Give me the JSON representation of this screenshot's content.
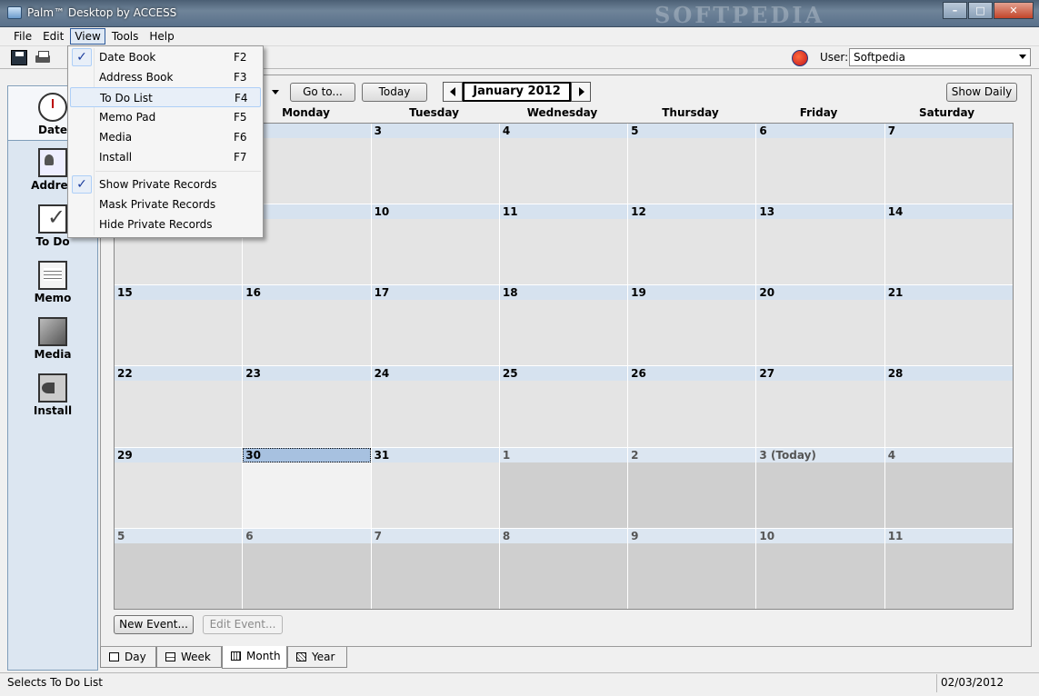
{
  "window": {
    "title": "Palm™ Desktop by ACCESS",
    "watermark": "SOFTPEDIA",
    "minimize": "–",
    "maximize": "□",
    "close": "✕"
  },
  "menubar": [
    "File",
    "Edit",
    "View",
    "Tools",
    "Help"
  ],
  "toolbar": {
    "user_label": "User:",
    "user_value": "Softpedia"
  },
  "view_menu": {
    "items": [
      {
        "label": "Date Book",
        "shortcut": "F2",
        "checked": true
      },
      {
        "label": "Address Book",
        "shortcut": "F3"
      },
      {
        "label": "To Do List",
        "shortcut": "F4",
        "hover": true
      },
      {
        "label": "Memo Pad",
        "shortcut": "F5"
      },
      {
        "label": "Media",
        "shortcut": "F6"
      },
      {
        "label": "Install",
        "shortcut": "F7"
      }
    ],
    "private_items": [
      {
        "label": "Show Private Records",
        "checked": true
      },
      {
        "label": "Mask Private Records"
      },
      {
        "label": "Hide Private Records"
      }
    ]
  },
  "sidebar": {
    "items": [
      {
        "label": "Date",
        "icon": "date-book-icon"
      },
      {
        "label": "Addres",
        "icon": "address-book-icon"
      },
      {
        "label": "To Do",
        "icon": "todo-list-icon"
      },
      {
        "label": "Memo",
        "icon": "memo-pad-icon"
      },
      {
        "label": "Media",
        "icon": "media-icon"
      },
      {
        "label": "Install",
        "icon": "install-icon"
      }
    ]
  },
  "calendar": {
    "goto_label": "Go to...",
    "today_label": "Today",
    "month_label": "January 2012",
    "show_daily_label": "Show Daily",
    "weekdays": [
      "",
      "Monday",
      "Tuesday",
      "Wednesday",
      "Thursday",
      "Friday",
      "Saturday"
    ],
    "weeks": [
      [
        {
          "d": ""
        },
        {
          "d": ""
        },
        {
          "d": "3"
        },
        {
          "d": "4"
        },
        {
          "d": "5"
        },
        {
          "d": "6"
        },
        {
          "d": "7"
        }
      ],
      [
        {
          "d": ""
        },
        {
          "d": ""
        },
        {
          "d": "10"
        },
        {
          "d": "11"
        },
        {
          "d": "12"
        },
        {
          "d": "13"
        },
        {
          "d": "14"
        }
      ],
      [
        {
          "d": "15"
        },
        {
          "d": "16"
        },
        {
          "d": "17"
        },
        {
          "d": "18"
        },
        {
          "d": "19"
        },
        {
          "d": "20"
        },
        {
          "d": "21"
        }
      ],
      [
        {
          "d": "22"
        },
        {
          "d": "23"
        },
        {
          "d": "24"
        },
        {
          "d": "25"
        },
        {
          "d": "26"
        },
        {
          "d": "27"
        },
        {
          "d": "28"
        }
      ],
      [
        {
          "d": "29"
        },
        {
          "d": "30",
          "selected": true
        },
        {
          "d": "31"
        },
        {
          "d": "1",
          "other": true
        },
        {
          "d": "2",
          "other": true
        },
        {
          "d": "3 (Today)",
          "other": true
        },
        {
          "d": "4",
          "other": true
        }
      ],
      [
        {
          "d": "5",
          "other": true
        },
        {
          "d": "6",
          "other": true
        },
        {
          "d": "7",
          "other": true
        },
        {
          "d": "8",
          "other": true
        },
        {
          "d": "9",
          "other": true
        },
        {
          "d": "10",
          "other": true
        },
        {
          "d": "11",
          "other": true
        }
      ]
    ],
    "new_event_label": "New Event...",
    "edit_event_label": "Edit Event..."
  },
  "tabs": [
    "Day",
    "Week",
    "Month",
    "Year"
  ],
  "statusbar": {
    "text": "Selects To Do List",
    "date": "02/03/2012"
  }
}
